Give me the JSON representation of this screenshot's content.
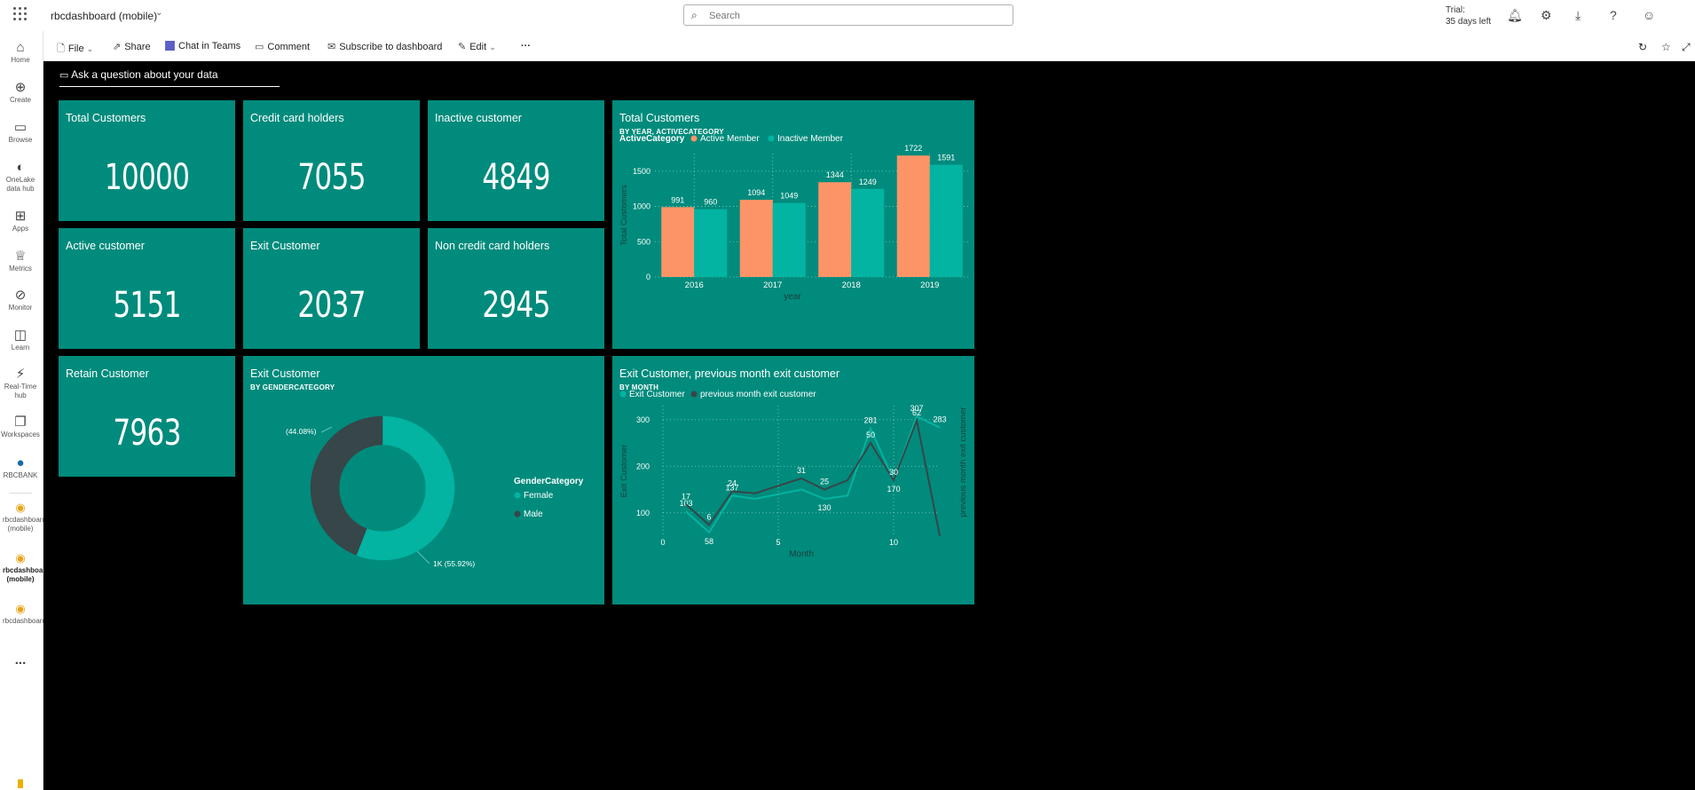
{
  "header": {
    "app_title": "rbcdashboard (mobile)",
    "search_placeholder": "Search",
    "trial_line1": "Trial:",
    "trial_line2": "35 days left"
  },
  "nav": [
    {
      "label": "Home"
    },
    {
      "label": "Create"
    },
    {
      "label": "Browse"
    },
    {
      "label": "OneLake data hub"
    },
    {
      "label": "Apps"
    },
    {
      "label": "Metrics"
    },
    {
      "label": "Monitor"
    },
    {
      "label": "Learn"
    },
    {
      "label": "Real-Time hub"
    },
    {
      "label": "Workspaces"
    },
    {
      "label": "RBCBANK"
    },
    {
      "label": "rbcdashboard (mobile)"
    },
    {
      "label": "rbcdashboard (mobile)"
    },
    {
      "label": "rbcdashboard"
    },
    {
      "label": "..."
    }
  ],
  "actions": {
    "file": "File",
    "share": "Share",
    "chat": "Chat in Teams",
    "comment": "Comment",
    "subscribe": "Subscribe to dashboard",
    "edit": "Edit",
    "more": "···"
  },
  "qa_label": "Ask a question about your data",
  "cards": [
    {
      "title": "Total Customers",
      "value": "10000"
    },
    {
      "title": "Credit card holders",
      "value": "7055"
    },
    {
      "title": "Inactive customer",
      "value": "4849"
    },
    {
      "title": "Active customer",
      "value": "5151"
    },
    {
      "title": "Exit Customer",
      "value": "2037"
    },
    {
      "title": "Non credit card holders",
      "value": "2945"
    },
    {
      "title": "Retain Customer",
      "value": "7963"
    }
  ],
  "colors": {
    "teal_bg": "#008b7c",
    "active": "#fd9467",
    "inactive": "#03b4a2",
    "male": "#374649"
  },
  "chart_data": [
    {
      "type": "bar",
      "title": "Total Customers",
      "subtitle": "BY YEAR, ACTIVECATEGORY",
      "legend_title": "ActiveCategory",
      "xlabel": "year",
      "ylabel": "Total Customers",
      "categories": [
        "2016",
        "2017",
        "2018",
        "2019"
      ],
      "series": [
        {
          "name": "Active Member",
          "values": [
            991,
            1094,
            1344,
            1722
          ]
        },
        {
          "name": "Inactive Member",
          "values": [
            960,
            1049,
            1249,
            1591
          ]
        }
      ],
      "ylim": [
        0,
        1750
      ],
      "yticks": [
        0,
        500,
        1000,
        1500
      ],
      "grid": true,
      "legend": "top-left"
    },
    {
      "type": "pie",
      "variant": "donut",
      "title": "Exit Customer",
      "subtitle": "BY GENDERCATEGORY",
      "legend_title": "GenderCategory",
      "slices": [
        {
          "name": "Female",
          "value": 55.92,
          "label": "1K (55.92%)"
        },
        {
          "name": "Male",
          "value": 44.08,
          "label": "(44.08%)"
        }
      ],
      "legend": "right"
    },
    {
      "type": "line",
      "title": "Exit Customer, previous month exit customer",
      "subtitle": "BY MONTH",
      "xlabel": "Month",
      "ylabel": "Exit Customer",
      "y2label": "previous month exit customer",
      "x": [
        1,
        2,
        3,
        4,
        5,
        6,
        7,
        8,
        9,
        10,
        11,
        12
      ],
      "series": [
        {
          "name": "Exit Customer",
          "axis": "left",
          "values": [
            103,
            58,
            137,
            130,
            140,
            150,
            130,
            137,
            281,
            170,
            307,
            283
          ],
          "labels": [
            "103",
            "58",
            "137",
            "",
            "",
            "",
            "130",
            "",
            "281",
            "170",
            "307",
            "283"
          ]
        },
        {
          "name": "previous month exit customer",
          "axis": "right",
          "values": [
            17,
            6,
            24,
            23,
            27,
            31,
            25,
            30,
            50,
            30,
            62,
            0
          ],
          "labels": [
            "17",
            "6",
            "24",
            "",
            "",
            "31",
            "25",
            "",
            "50",
            "30",
            "62",
            ""
          ]
        }
      ],
      "x_ticks": [
        0,
        5,
        10
      ],
      "y_ticks": [
        100,
        200,
        300
      ],
      "xlim": [
        0,
        12
      ],
      "ylim": [
        50,
        330
      ],
      "y2lim": [
        0,
        70
      ],
      "grid": true,
      "legend": "top-left"
    }
  ]
}
